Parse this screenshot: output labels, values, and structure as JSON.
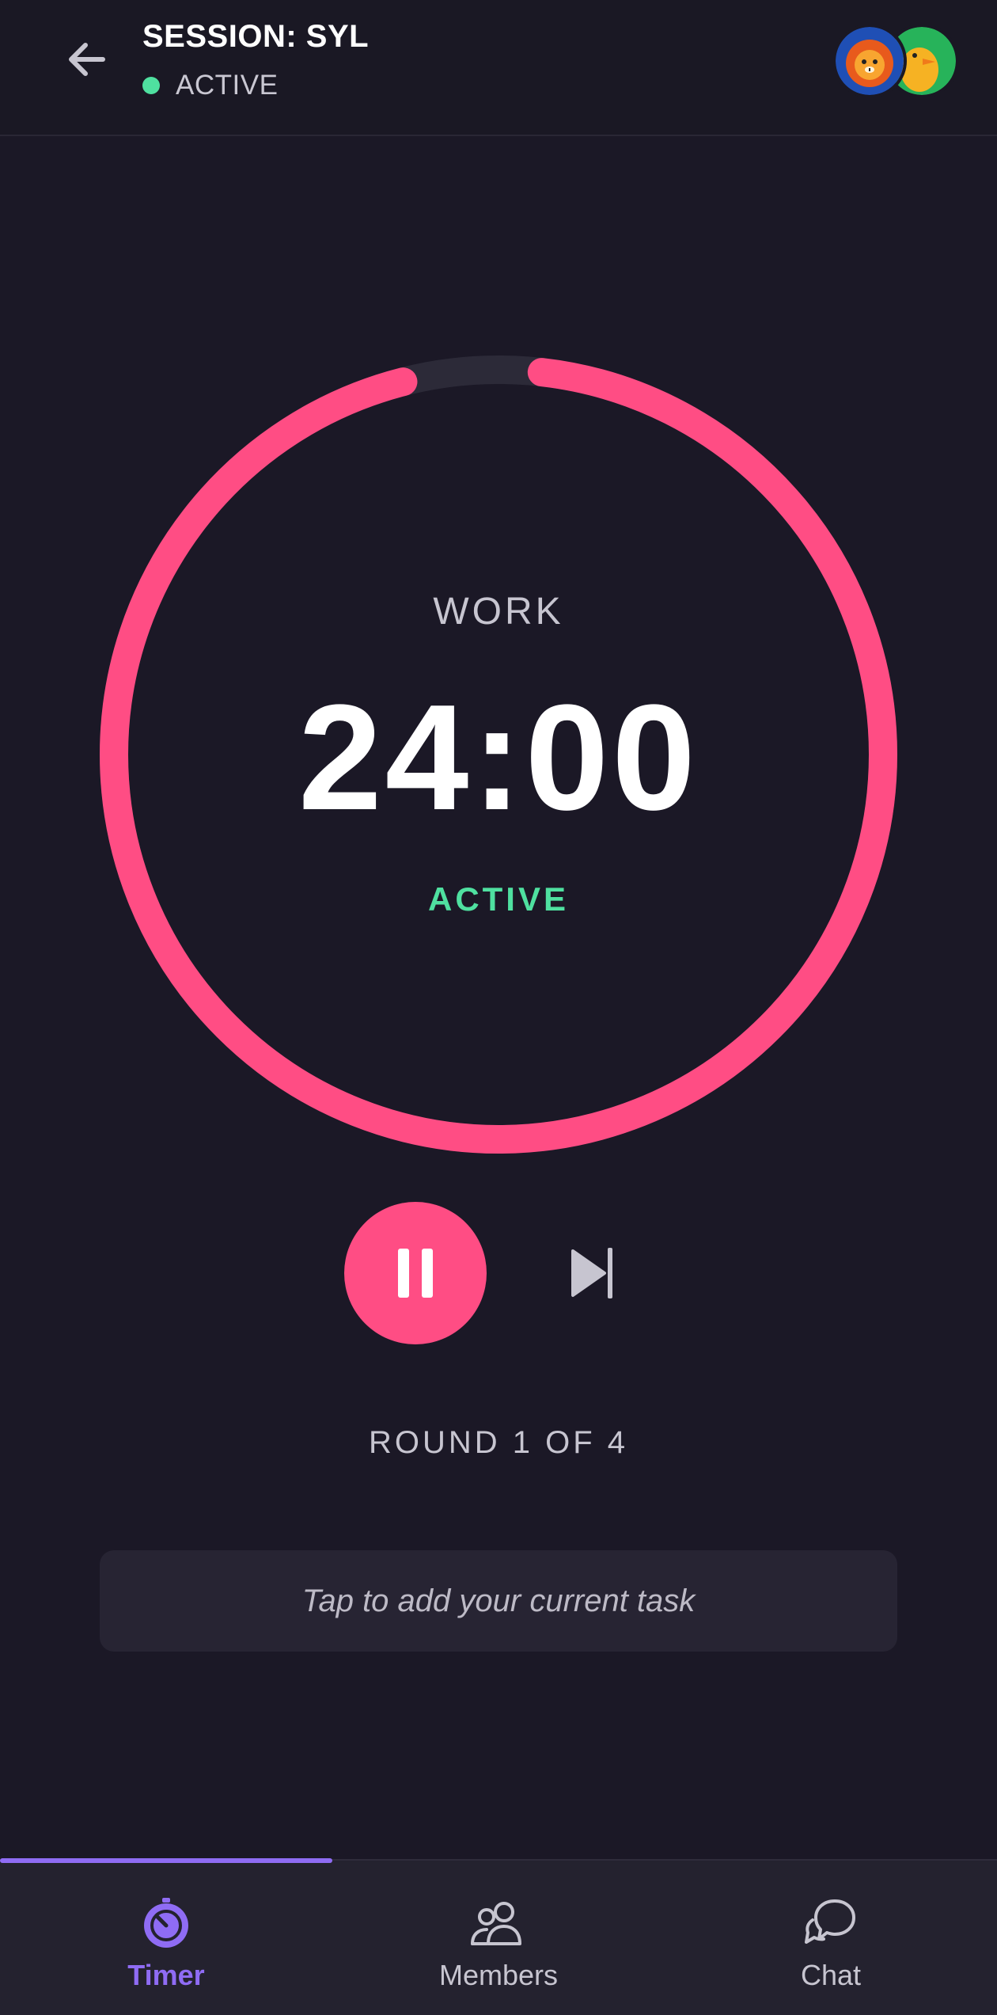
{
  "header": {
    "title": "SESSION: SYL",
    "status": "ACTIVE",
    "back_icon": "arrow-left-icon",
    "avatars": [
      "lion-avatar",
      "duck-avatar"
    ]
  },
  "timer": {
    "phase": "WORK",
    "time": "24:00",
    "state": "ACTIVE",
    "progress_remaining": 0.96,
    "ring_color": "#ff4d84",
    "track_color": "#2c2a38",
    "state_color": "#4fe0a0"
  },
  "controls": {
    "pause_icon": "pause-icon",
    "skip_icon": "skip-next-icon"
  },
  "round": {
    "label": "ROUND 1 OF 4"
  },
  "task": {
    "placeholder": "Tap to add your current task"
  },
  "nav": {
    "items": [
      {
        "label": "Timer",
        "icon": "timer-icon",
        "active": true
      },
      {
        "label": "Members",
        "icon": "members-icon",
        "active": false
      },
      {
        "label": "Chat",
        "icon": "chat-icon",
        "active": false
      }
    ],
    "accent": "#8f6cf4"
  }
}
